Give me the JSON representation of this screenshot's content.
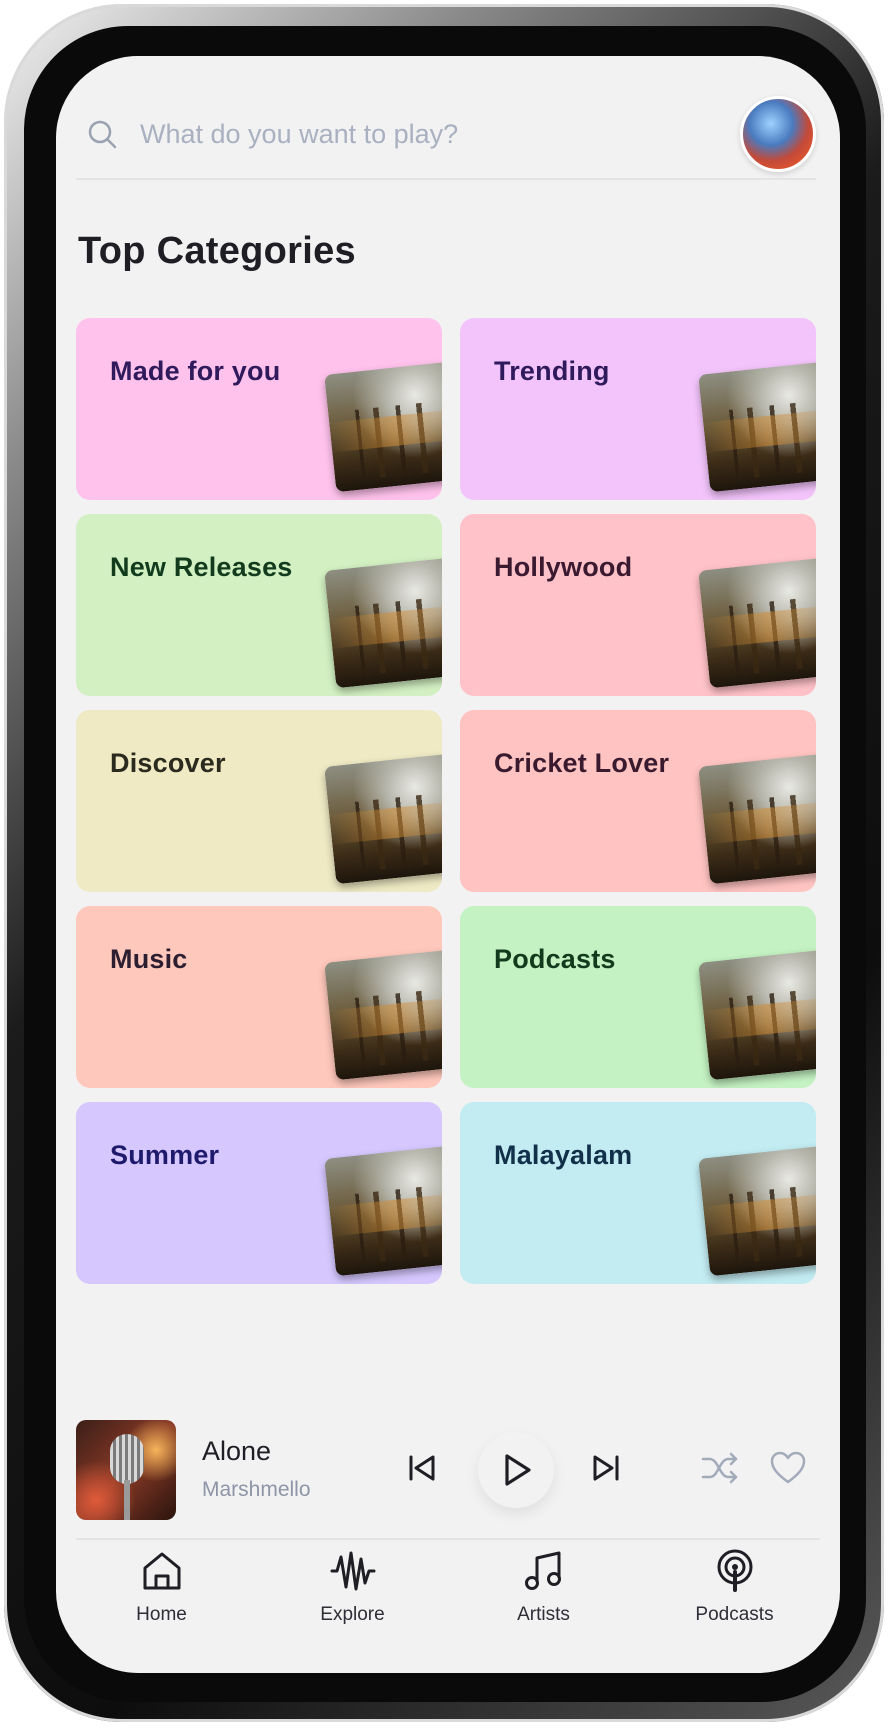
{
  "search": {
    "placeholder": "What do you want to play?",
    "icon": "search-icon",
    "avatar_icon": "avatar"
  },
  "section": {
    "title": "Top Categories"
  },
  "categories": [
    {
      "label": "Made for you",
      "bg": "#ffc2ec",
      "fg": "#2f1a5c"
    },
    {
      "label": "Trending",
      "bg": "#f3c4fb",
      "fg": "#2f1a5c"
    },
    {
      "label": "New Releases",
      "bg": "#d2f0c2",
      "fg": "#123b1e"
    },
    {
      "label": "Hollywood",
      "bg": "#ffc2c8",
      "fg": "#3a1a30"
    },
    {
      "label": "Discover",
      "bg": "#efeac4",
      "fg": "#2b2a1e"
    },
    {
      "label": "Cricket Lover",
      "bg": "#ffc4c2",
      "fg": "#3a1a2e"
    },
    {
      "label": "Music",
      "bg": "#ffc8bc",
      "fg": "#2b1e30"
    },
    {
      "label": "Podcasts",
      "bg": "#c4f2c2",
      "fg": "#123b1e"
    },
    {
      "label": "Summer",
      "bg": "#d6c8ff",
      "fg": "#1e1a6c"
    },
    {
      "label": "Malayalam",
      "bg": "#c2ecf2",
      "fg": "#12304a"
    }
  ],
  "player": {
    "title": "Alone",
    "artist": "Marshmello",
    "controls": [
      "previous-icon",
      "play-icon",
      "next-icon",
      "shuffle-icon",
      "heart-icon"
    ]
  },
  "nav": [
    {
      "label": "Home",
      "icon": "home-icon"
    },
    {
      "label": "Explore",
      "icon": "waveform-icon"
    },
    {
      "label": "Artists",
      "icon": "music-note-icon"
    },
    {
      "label": "Podcasts",
      "icon": "podcast-icon"
    }
  ],
  "colors": {
    "screen_bg": "#f2f2f3",
    "text_primary": "#1e1e24",
    "text_muted": "#a9b0c0"
  }
}
